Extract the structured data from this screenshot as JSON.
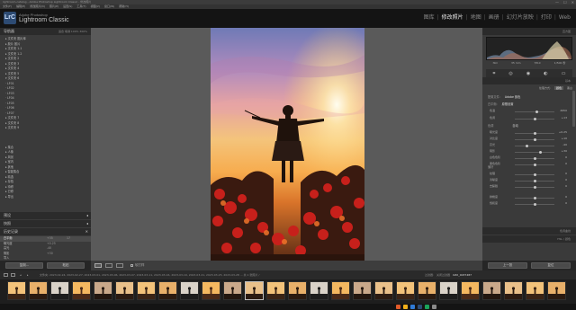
{
  "window": {
    "title": "lightroom-catalog - Adobe Photoshop Lightroom Classic - 修改照片",
    "controls": [
      "—",
      "☐",
      "✕"
    ]
  },
  "menubar": [
    "文件(F)",
    "编辑(E)",
    "修改照片(D)",
    "照片(P)",
    "设置(S)",
    "工具(T)",
    "视图(V)",
    "窗口(W)",
    "帮助(H)"
  ],
  "app": {
    "logo": "LrC",
    "brand_small": "Adobe Photoshop",
    "brand_name": "Lightroom Classic"
  },
  "modules": [
    {
      "label": "图库",
      "active": false
    },
    {
      "label": "修改照片",
      "active": true
    },
    {
      "label": "地图",
      "active": false
    },
    {
      "label": "画册",
      "active": false
    },
    {
      "label": "幻灯片放映",
      "active": false
    },
    {
      "label": "打印",
      "active": false
    },
    {
      "label": "Web",
      "active": false
    }
  ],
  "left_panel": {
    "navigator_title": "导航器",
    "navigator_controls": "适合  填满  100%  300%",
    "folders": [
      "▸ 文件夹  图片库",
      "▸ 胶片  胶片",
      "▸ 文件夹 1-1",
      "▸ 文件夹 1-2",
      "▸ 文件夹 2",
      "▸ 文件夹 3",
      "▸ 文件夹 4",
      "▸ 文件夹 5",
      "▾ 文件夹 6",
      "   · LF01",
      "   · LF02",
      "   · LF03",
      "   · LF04",
      "   · LF05",
      "   · LF06",
      "   · LF07",
      "▸ 文件夹 7",
      "▸ 文件夹 8",
      "▸ 文件夹 9"
    ],
    "sections": [
      "▸ 集合",
      "▸ 人像",
      "▸ 风景",
      "▸ 室内",
      "▸ 其他",
      "▸ 智能集合",
      "▸ 精选",
      "▸ 存档",
      "▸ 待修",
      "▸ 已修",
      "▸ 导出"
    ],
    "presets_title": "预设",
    "snapshots_title": "快照",
    "history_title": "历史记录",
    "history": [
      {
        "label": "白平衡",
        "value": "+35",
        "value2": "17",
        "selected": true
      },
      {
        "label": "曝光度",
        "value": "+0.25",
        "value2": "",
        "selected": false
      },
      {
        "label": "高光",
        "value": "-40",
        "value2": "",
        "selected": false
      },
      {
        "label": "阴影",
        "value": "+30",
        "value2": "",
        "selected": false
      },
      {
        "label": "导入",
        "value": "",
        "value2": "",
        "selected": false
      }
    ],
    "copy_button": "复制...",
    "paste_button": "粘贴"
  },
  "right_panel": {
    "histogram_title": "直方图",
    "histogram_info": [
      "ISO",
      "35 mm",
      "f/8.0",
      "1/500 秒"
    ],
    "basic_title": "基本",
    "treatment_label": "处理方式:",
    "treatment_color": "颜色",
    "treatment_bw": "黑白",
    "profile_label": "配置文件:",
    "profile_value": "Adobe 颜色",
    "wb_label": "白平衡:",
    "wb_value": "原照设置",
    "tone_title": "色调",
    "tone_auto": "自动",
    "presence_title": "偏好",
    "sliders": [
      {
        "label": "色温",
        "value": "4950",
        "pos": 0.55
      },
      {
        "label": "色调",
        "value": "+13",
        "pos": 0.52
      },
      {
        "label": "曝光度",
        "value": "+0.25",
        "pos": 0.52
      },
      {
        "label": "对比度",
        "value": "+10",
        "pos": 0.52
      },
      {
        "label": "高光",
        "value": "-40",
        "pos": 0.3
      },
      {
        "label": "阴影",
        "value": "+30",
        "pos": 0.65
      },
      {
        "label": "白色色阶",
        "value": "0",
        "pos": 0.5
      },
      {
        "label": "黑色色阶",
        "value": "0",
        "pos": 0.5
      },
      {
        "label": "纹理",
        "value": "0",
        "pos": 0.5
      },
      {
        "label": "清晰度",
        "value": "0",
        "pos": 0.5
      },
      {
        "label": "去朦胧",
        "value": "0",
        "pos": 0.5
      },
      {
        "label": "鲜艳度",
        "value": "0",
        "pos": 0.5
      },
      {
        "label": "饱和度",
        "value": "0",
        "pos": 0.5
      }
    ],
    "tone_curve_title": "色调曲线",
    "hsl_title": "HSL / 颜色",
    "prev_button": "上一张",
    "reset_button": "复位"
  },
  "toolbar": {
    "softproof_label": "软打样"
  },
  "filmstrip": {
    "info": "文件夹: 2023-02-24, 2023-02-27, 2023-03-01, 2023-03-06, 2023-03-07, 2023-03-11, 2023-03-16, 2023-03-19, 2023-03-21, 2023-03-25, 2023-03-28 ... 共 1 张照片 /",
    "filter_label": "过滤器:",
    "filter_value": "关闭过滤器",
    "filename": "XZX_0037487",
    "thumb_count": 26,
    "selected_index": 11
  }
}
